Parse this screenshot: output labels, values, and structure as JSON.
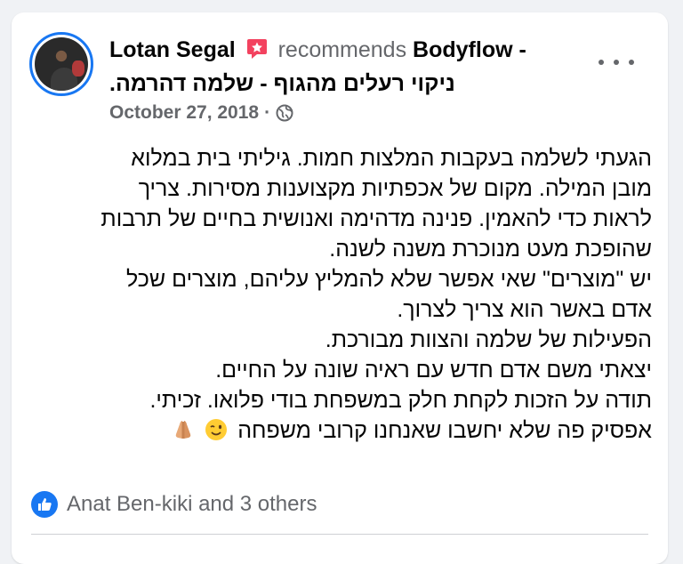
{
  "post": {
    "author": "Lotan Segal",
    "verb": "recommends",
    "page_name_en": "Bodyflow -",
    "page_name_he": "ניקוי רעלים מהגוף - שלמה דהרמה.",
    "date": "October 27, 2018",
    "separator": "·",
    "privacy_icon": "globe-icon",
    "more_icon": "more-options-icon",
    "body_lines": [
      "הגעתי לשלמה בעקבות המלצות חמות. גיליתי בית במלוא",
      "מובן המילה. מקום של אכפתיות מקצוענות מסירות. צריך",
      "לראות כדי להאמין. פנינה מדהימה ואנושית בחיים של תרבות",
      "שהופכת מעט מנוכרת משנה לשנה.",
      "יש \"מוצרים\" שאי אפשר שלא להמליץ עליהם, מוצרים שכל",
      "אדם באשר הוא צריך לצרוך.",
      "הפעילות של שלמה והצוות מבורכת.",
      "יצאתי משם אדם חדש עם ראיה שונה על החיים.",
      "תודה על הזכות לקחת חלק במשפחת בודי פלואו. זכיתי.",
      "אפסיק פה שלא יחשבו שאנחנו קרובי משפחה"
    ],
    "last_line_emojis": [
      "wink-emoji",
      "folded-hands-emoji"
    ]
  },
  "reactions": {
    "icon": "like-icon",
    "text": "Anat Ben-kiki and 3 others"
  },
  "colors": {
    "accent": "#1877f2",
    "recommend_badge": "#f3425f",
    "secondary_text": "#65676b",
    "background": "#f0f2f5"
  }
}
